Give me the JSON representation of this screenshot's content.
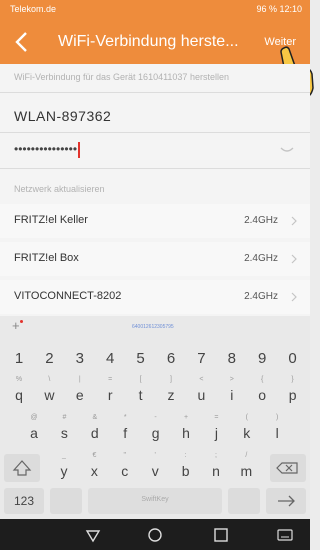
{
  "status": {
    "carrier": "Telekom.de",
    "right": "96 % 12:10"
  },
  "appbar": {
    "title": "WiFi-Verbindung herste...",
    "next_label": "Weiter"
  },
  "form": {
    "hint": "WiFi-Verbindung für das Gerät 1610411037 herstellen",
    "ssid": "WLAN-897362",
    "password_mask": "•••••••••••••••",
    "refresh_label": "Netzwerk aktualisieren"
  },
  "networks": [
    {
      "name": "FRITZ!el Keller",
      "band": "2.4GHz"
    },
    {
      "name": "FRITZ!el Box",
      "band": "2.4GHz"
    },
    {
      "name": "VITOCONNECT-8202",
      "band": "2.4GHz"
    }
  ],
  "keyboard": {
    "plus": "+",
    "suggestion": "640012612305795",
    "numbers": [
      "1",
      "2",
      "3",
      "4",
      "5",
      "6",
      "7",
      "8",
      "9",
      "0"
    ],
    "row1": [
      {
        "k": "q",
        "s": "%"
      },
      {
        "k": "w",
        "s": "\\"
      },
      {
        "k": "e",
        "s": "|"
      },
      {
        "k": "r",
        "s": "="
      },
      {
        "k": "t",
        "s": "["
      },
      {
        "k": "z",
        "s": "]"
      },
      {
        "k": "u",
        "s": "<"
      },
      {
        "k": "i",
        "s": ">"
      },
      {
        "k": "o",
        "s": "{"
      },
      {
        "k": "p",
        "s": "}"
      }
    ],
    "row2": [
      {
        "k": "a",
        "s": "@"
      },
      {
        "k": "s",
        "s": "#"
      },
      {
        "k": "d",
        "s": "&"
      },
      {
        "k": "f",
        "s": "*"
      },
      {
        "k": "g",
        "s": "-"
      },
      {
        "k": "h",
        "s": "+"
      },
      {
        "k": "j",
        "s": "="
      },
      {
        "k": "k",
        "s": "("
      },
      {
        "k": "l",
        "s": ")"
      }
    ],
    "row3": [
      {
        "k": "y",
        "s": "_"
      },
      {
        "k": "x",
        "s": "€"
      },
      {
        "k": "c",
        "s": "\""
      },
      {
        "k": "v",
        "s": "'"
      },
      {
        "k": "b",
        "s": ":"
      },
      {
        "k": "n",
        "s": ";"
      },
      {
        "k": "m",
        "s": "/"
      }
    ],
    "num_toggle": "123",
    "space_brand": "SwiftKey"
  },
  "colors": {
    "accent": "#ee8c3c",
    "cursor": "#e2332c"
  }
}
